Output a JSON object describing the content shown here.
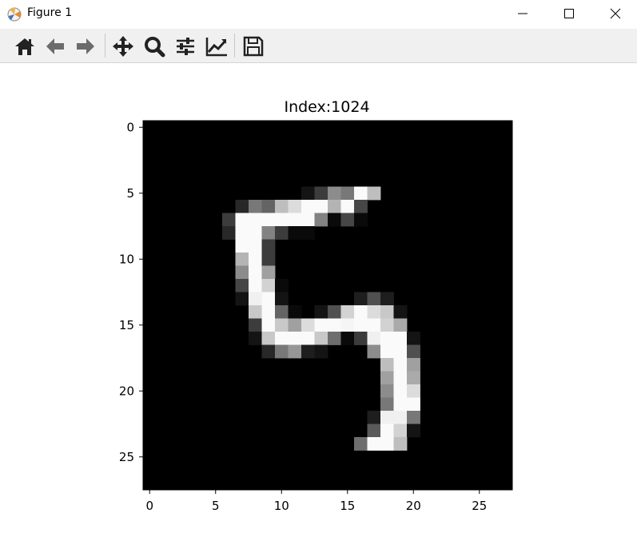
{
  "window": {
    "title": "Figure 1",
    "app_icon": "matplotlib-logo-icon",
    "controls": [
      "minimize-icon",
      "maximize-icon",
      "close-icon"
    ]
  },
  "toolbar": {
    "buttons": [
      {
        "name": "home",
        "icon": "home-icon"
      },
      {
        "name": "back",
        "icon": "arrow-left-icon"
      },
      {
        "name": "forward",
        "icon": "arrow-right-icon"
      },
      {
        "name": "pan",
        "icon": "move-arrows-icon"
      },
      {
        "name": "zoom",
        "icon": "magnifier-icon"
      },
      {
        "name": "configure-subplots",
        "icon": "sliders-icon"
      },
      {
        "name": "edit-axis",
        "icon": "chart-line-icon"
      },
      {
        "name": "save",
        "icon": "floppy-disk-icon"
      }
    ]
  },
  "chart_data": {
    "type": "heatmap",
    "title": "Index:1024",
    "xlabel": "",
    "ylabel": "",
    "colormap": "gray",
    "value_range": [
      0,
      255
    ],
    "xlim": [
      -0.5,
      27.5
    ],
    "ylim": [
      27.5,
      -0.5
    ],
    "xticks": [
      0,
      5,
      10,
      15,
      20,
      25
    ],
    "yticks": [
      0,
      5,
      10,
      15,
      20,
      25
    ],
    "grid": false,
    "shape": [
      28,
      28
    ],
    "pixels": [
      [
        0,
        0,
        0,
        0,
        0,
        0,
        0,
        0,
        0,
        0,
        0,
        0,
        0,
        0,
        0,
        0,
        0,
        0,
        0,
        0,
        0,
        0,
        0,
        0,
        0,
        0,
        0,
        0
      ],
      [
        0,
        0,
        0,
        0,
        0,
        0,
        0,
        0,
        0,
        0,
        0,
        0,
        0,
        0,
        0,
        0,
        0,
        0,
        0,
        0,
        0,
        0,
        0,
        0,
        0,
        0,
        0,
        0
      ],
      [
        0,
        0,
        0,
        0,
        0,
        0,
        0,
        0,
        0,
        0,
        0,
        0,
        0,
        0,
        0,
        0,
        0,
        0,
        0,
        0,
        0,
        0,
        0,
        0,
        0,
        0,
        0,
        0
      ],
      [
        0,
        0,
        0,
        0,
        0,
        0,
        0,
        0,
        0,
        0,
        0,
        0,
        0,
        0,
        0,
        0,
        0,
        0,
        0,
        0,
        0,
        0,
        0,
        0,
        0,
        0,
        0,
        0
      ],
      [
        0,
        0,
        0,
        0,
        0,
        0,
        0,
        0,
        0,
        0,
        0,
        0,
        0,
        0,
        0,
        0,
        0,
        0,
        0,
        0,
        0,
        0,
        0,
        0,
        0,
        0,
        0,
        0
      ],
      [
        0,
        0,
        0,
        0,
        0,
        0,
        0,
        0,
        0,
        0,
        0,
        0,
        20,
        60,
        140,
        120,
        250,
        190,
        0,
        0,
        0,
        0,
        0,
        0,
        0,
        0,
        0,
        0
      ],
      [
        0,
        0,
        0,
        0,
        0,
        0,
        0,
        40,
        120,
        100,
        190,
        220,
        250,
        250,
        180,
        250,
        70,
        0,
        0,
        0,
        0,
        0,
        0,
        0,
        0,
        0,
        0,
        0
      ],
      [
        0,
        0,
        0,
        0,
        0,
        0,
        60,
        250,
        250,
        250,
        250,
        250,
        250,
        130,
        10,
        70,
        10,
        0,
        0,
        0,
        0,
        0,
        0,
        0,
        0,
        0,
        0,
        0
      ],
      [
        0,
        0,
        0,
        0,
        0,
        0,
        40,
        250,
        250,
        130,
        60,
        10,
        10,
        0,
        0,
        0,
        0,
        0,
        0,
        0,
        0,
        0,
        0,
        0,
        0,
        0,
        0,
        0
      ],
      [
        0,
        0,
        0,
        0,
        0,
        0,
        0,
        250,
        250,
        60,
        0,
        0,
        0,
        0,
        0,
        0,
        0,
        0,
        0,
        0,
        0,
        0,
        0,
        0,
        0,
        0,
        0,
        0
      ],
      [
        0,
        0,
        0,
        0,
        0,
        0,
        0,
        180,
        250,
        60,
        0,
        0,
        0,
        0,
        0,
        0,
        0,
        0,
        0,
        0,
        0,
        0,
        0,
        0,
        0,
        0,
        0,
        0
      ],
      [
        0,
        0,
        0,
        0,
        0,
        0,
        0,
        140,
        250,
        160,
        0,
        0,
        0,
        0,
        0,
        0,
        0,
        0,
        0,
        0,
        0,
        0,
        0,
        0,
        0,
        0,
        0,
        0
      ],
      [
        0,
        0,
        0,
        0,
        0,
        0,
        0,
        70,
        250,
        210,
        10,
        0,
        0,
        0,
        0,
        0,
        0,
        0,
        0,
        0,
        0,
        0,
        0,
        0,
        0,
        0,
        0,
        0
      ],
      [
        0,
        0,
        0,
        0,
        0,
        0,
        0,
        20,
        240,
        250,
        20,
        0,
        0,
        0,
        0,
        0,
        30,
        80,
        30,
        0,
        0,
        0,
        0,
        0,
        0,
        0,
        0,
        0
      ],
      [
        0,
        0,
        0,
        0,
        0,
        0,
        0,
        0,
        200,
        250,
        100,
        10,
        0,
        20,
        80,
        210,
        250,
        220,
        200,
        20,
        0,
        0,
        0,
        0,
        0,
        0,
        0,
        0
      ],
      [
        0,
        0,
        0,
        0,
        0,
        0,
        0,
        0,
        60,
        250,
        200,
        160,
        220,
        250,
        250,
        245,
        250,
        250,
        210,
        170,
        0,
        0,
        0,
        0,
        0,
        0,
        0,
        0
      ],
      [
        0,
        0,
        0,
        0,
        0,
        0,
        0,
        0,
        20,
        200,
        250,
        250,
        250,
        200,
        110,
        10,
        60,
        240,
        250,
        250,
        20,
        0,
        0,
        0,
        0,
        0,
        0,
        0
      ],
      [
        0,
        0,
        0,
        0,
        0,
        0,
        0,
        0,
        0,
        40,
        120,
        150,
        30,
        20,
        0,
        0,
        0,
        140,
        250,
        250,
        80,
        0,
        0,
        0,
        0,
        0,
        0,
        0
      ],
      [
        0,
        0,
        0,
        0,
        0,
        0,
        0,
        0,
        0,
        0,
        0,
        0,
        0,
        0,
        0,
        0,
        0,
        0,
        190,
        250,
        160,
        0,
        0,
        0,
        0,
        0,
        0,
        0
      ],
      [
        0,
        0,
        0,
        0,
        0,
        0,
        0,
        0,
        0,
        0,
        0,
        0,
        0,
        0,
        0,
        0,
        0,
        0,
        160,
        250,
        170,
        0,
        0,
        0,
        0,
        0,
        0,
        0
      ],
      [
        0,
        0,
        0,
        0,
        0,
        0,
        0,
        0,
        0,
        0,
        0,
        0,
        0,
        0,
        0,
        0,
        0,
        0,
        140,
        250,
        220,
        0,
        0,
        0,
        0,
        0,
        0,
        0
      ],
      [
        0,
        0,
        0,
        0,
        0,
        0,
        0,
        0,
        0,
        0,
        0,
        0,
        0,
        0,
        0,
        0,
        0,
        0,
        120,
        250,
        250,
        0,
        0,
        0,
        0,
        0,
        0,
        0
      ],
      [
        0,
        0,
        0,
        0,
        0,
        0,
        0,
        0,
        0,
        0,
        0,
        0,
        0,
        0,
        0,
        0,
        0,
        30,
        240,
        240,
        120,
        0,
        0,
        0,
        0,
        0,
        0,
        0
      ],
      [
        0,
        0,
        0,
        0,
        0,
        0,
        0,
        0,
        0,
        0,
        0,
        0,
        0,
        0,
        0,
        0,
        0,
        90,
        250,
        210,
        20,
        0,
        0,
        0,
        0,
        0,
        0,
        0
      ],
      [
        0,
        0,
        0,
        0,
        0,
        0,
        0,
        0,
        0,
        0,
        0,
        0,
        0,
        0,
        0,
        0,
        110,
        250,
        250,
        190,
        0,
        0,
        0,
        0,
        0,
        0,
        0,
        0
      ],
      [
        0,
        0,
        0,
        0,
        0,
        0,
        0,
        0,
        0,
        0,
        0,
        0,
        0,
        0,
        0,
        0,
        0,
        0,
        0,
        0,
        0,
        0,
        0,
        0,
        0,
        0,
        0,
        0
      ],
      [
        0,
        0,
        0,
        0,
        0,
        0,
        0,
        0,
        0,
        0,
        0,
        0,
        0,
        0,
        0,
        0,
        0,
        0,
        0,
        0,
        0,
        0,
        0,
        0,
        0,
        0,
        0,
        0
      ],
      [
        0,
        0,
        0,
        0,
        0,
        0,
        0,
        0,
        0,
        0,
        0,
        0,
        0,
        0,
        0,
        0,
        0,
        0,
        0,
        0,
        0,
        0,
        0,
        0,
        0,
        0,
        0,
        0
      ]
    ]
  }
}
